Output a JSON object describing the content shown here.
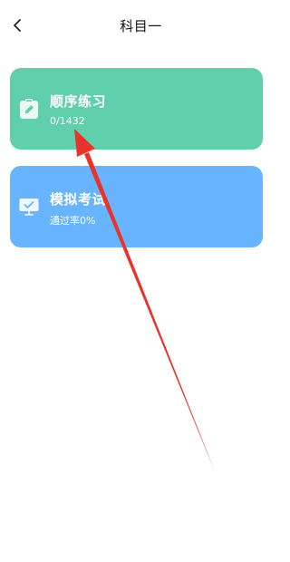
{
  "header": {
    "title": "科目一",
    "back_icon": "chevron-left-icon"
  },
  "cards": [
    {
      "title": "顺序练习",
      "subtitle": "0/1432",
      "color": "#5fd0ab",
      "icon": "clipboard-edit-icon"
    },
    {
      "title": "模拟考试",
      "subtitle": "通过率0%",
      "color": "#68b4ff",
      "icon": "monitor-check-icon"
    }
  ],
  "annotation": {
    "color": "#e8332c",
    "icon": "red-arrow-annotation"
  }
}
